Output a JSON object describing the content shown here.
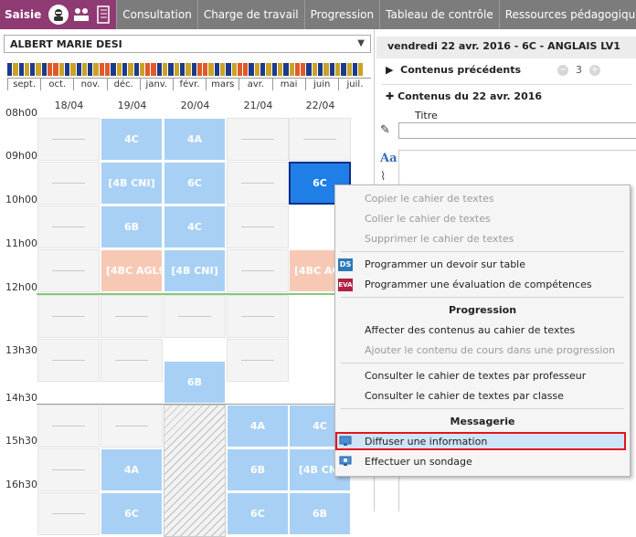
{
  "nav": {
    "active": "Saisie",
    "tabs": [
      "Consultation",
      "Charge de travail",
      "Progression",
      "Tableau de contrôle",
      "Ressources pédagogiques"
    ]
  },
  "teacher": {
    "name": "ALBERT MARIE DESI"
  },
  "months": [
    "sept.",
    "oct.",
    "nov.",
    "déc.",
    "janv.",
    "févr.",
    "mars",
    "avr.",
    "mai",
    "juin",
    "juil."
  ],
  "days": [
    "18/04",
    "19/04",
    "20/04",
    "21/04",
    "22/04"
  ],
  "hours": [
    "08h00",
    "09h00",
    "10h00",
    "11h00",
    "12h00",
    "13h30",
    "14h30",
    "15h30",
    "16h30"
  ],
  "courses": {
    "c1": "4C",
    "c2": "4A",
    "c3": "[4B CNI]",
    "c4": "6C",
    "c5": "6C",
    "c6": "6B",
    "c7": "4C",
    "c8": "[4BC AGL9",
    "c9": "[4B CNI]",
    "c10": "[4BC AG",
    "c11": "6B",
    "c12": "4A",
    "c13": "4C",
    "c14": "4A",
    "c15": "6B",
    "c16": "[4B CNI",
    "c17": "6C",
    "c18": "6C",
    "c19": "6B"
  },
  "session": {
    "title": "vendredi 22 avr. 2016 - 6C - ANGLAIS LV1",
    "previous_label": "Contenus précédents",
    "previous_count": "3",
    "current_label": "Contenus du 22 avr. 2016",
    "titre_label": "Titre"
  },
  "menu": {
    "copy": "Copier le cahier de textes",
    "paste": "Coller le cahier de textes",
    "delete": "Supprimer le cahier de textes",
    "ds_badge": "DS",
    "devoir": "Programmer un devoir sur table",
    "eva_badge": "EVA",
    "evaluation": "Programmer une évaluation de compétences",
    "progression_header": "Progression",
    "affecter": "Affecter des contenus au cahier de textes",
    "ajouter": "Ajouter le contenu de cours dans une progression",
    "consult_prof": "Consulter le cahier de textes par professeur",
    "consult_classe": "Consulter le cahier de textes par classe",
    "messagerie_header": "Messagerie",
    "diffuser": "Diffuser une information",
    "sondage": "Effectuer un sondage"
  },
  "colors": {
    "saisie": "#8f3a73",
    "course": "#a8d0f5",
    "selected": "#1f7fe6",
    "highlight": "#e3141c"
  }
}
